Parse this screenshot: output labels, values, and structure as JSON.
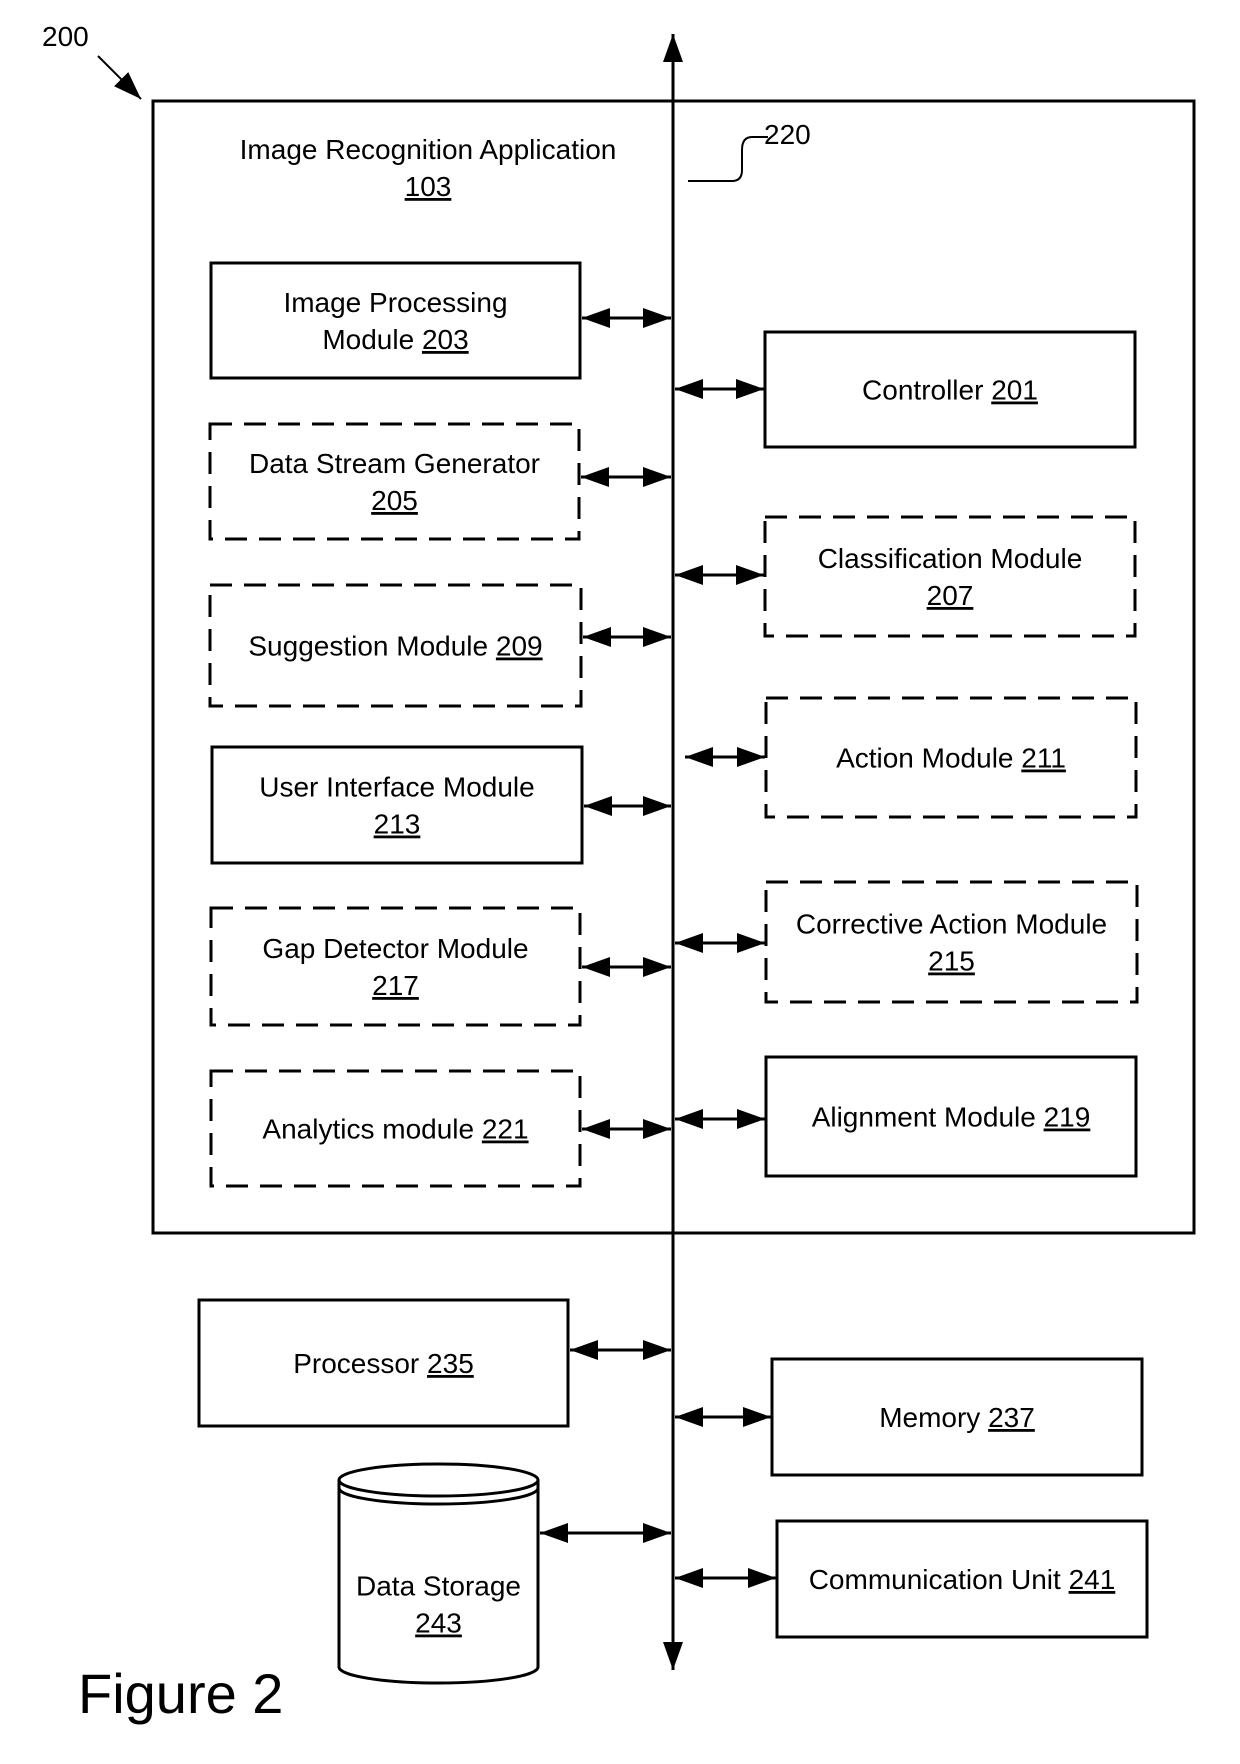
{
  "figure": {
    "ref_label": "200",
    "caption": "Figure 2",
    "bus_label": "220"
  },
  "application": {
    "name": "Image Recognition Application",
    "ref": "103"
  },
  "modules": [
    {
      "id": "image-processing",
      "lines": [
        "Image Processing",
        "Module "
      ],
      "ref": "203",
      "style": "solid"
    },
    {
      "id": "controller",
      "lines": [
        "Controller "
      ],
      "ref": "201",
      "style": "solid"
    },
    {
      "id": "data-stream-generator",
      "lines": [
        "Data Stream Generator",
        ""
      ],
      "ref": "205",
      "style": "dashed"
    },
    {
      "id": "classification",
      "lines": [
        "Classification Module",
        ""
      ],
      "ref": "207",
      "style": "dashed"
    },
    {
      "id": "suggestion",
      "lines": [
        "Suggestion Module "
      ],
      "ref": "209",
      "style": "dashed"
    },
    {
      "id": "action",
      "lines": [
        "Action Module "
      ],
      "ref": "211",
      "style": "dashed"
    },
    {
      "id": "user-interface",
      "lines": [
        "User Interface Module",
        ""
      ],
      "ref": "213",
      "style": "solid"
    },
    {
      "id": "corrective-action",
      "lines": [
        "Corrective Action Module",
        ""
      ],
      "ref": "215",
      "style": "dashed"
    },
    {
      "id": "gap-detector",
      "lines": [
        "Gap Detector Module",
        ""
      ],
      "ref": "217",
      "style": "dashed"
    },
    {
      "id": "alignment",
      "lines": [
        "Alignment Module "
      ],
      "ref": "219",
      "style": "solid"
    },
    {
      "id": "analytics",
      "lines": [
        "Analytics module "
      ],
      "ref": "221",
      "style": "dashed"
    }
  ],
  "components": [
    {
      "id": "processor",
      "lines": [
        "Processor "
      ],
      "ref": "235",
      "style": "solid"
    },
    {
      "id": "memory",
      "lines": [
        "Memory "
      ],
      "ref": "237",
      "style": "solid"
    },
    {
      "id": "communication-unit",
      "lines": [
        "Communication Unit "
      ],
      "ref": "241",
      "style": "solid"
    },
    {
      "id": "data-storage",
      "lines": [
        "Data Storage",
        ""
      ],
      "ref": "243",
      "style": "cylinder"
    }
  ]
}
